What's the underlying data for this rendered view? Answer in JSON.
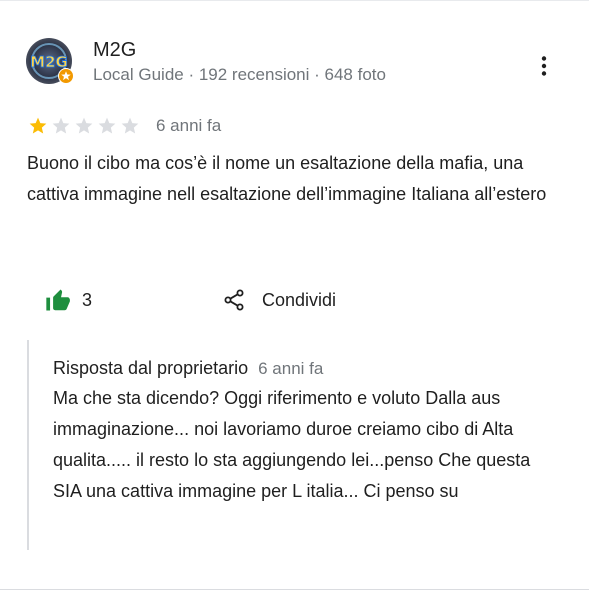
{
  "review": {
    "author_name": "M2G",
    "author_meta": "Local Guide · 192 recensioni · 648 foto",
    "avatar_text": "M2G",
    "rating": 1,
    "rating_max": 5,
    "date": "6 anni fa",
    "text": "Buono il cibo ma cos’è il nome un esaltazione della mafia, una cattiva immagine nell esaltazione dell’immagine Italiana all’estero"
  },
  "actions": {
    "like_count": "3",
    "share_label": "Condividi"
  },
  "owner_reply": {
    "title": "Risposta dal proprietario",
    "date": "6 anni fa",
    "text": "Ma che sta dicendo? Oggi riferimento e voluto Dalla aus immaginazione... noi lavoriamo duroe creiamo cibo di Alta qualita..... il resto lo sta aggiungendo lei...penso Che questa SIA una cattiva immagine per L italia... Ci penso su"
  },
  "colors": {
    "star_filled": "#fbbc04",
    "star_empty": "#dadce0",
    "like_icon": "#1e8e3e",
    "meta_text": "#70757a"
  },
  "icons": {
    "badge": "local-guide-badge-icon",
    "more": "more-vert-icon",
    "like": "thumb-up-icon",
    "share": "share-icon"
  }
}
